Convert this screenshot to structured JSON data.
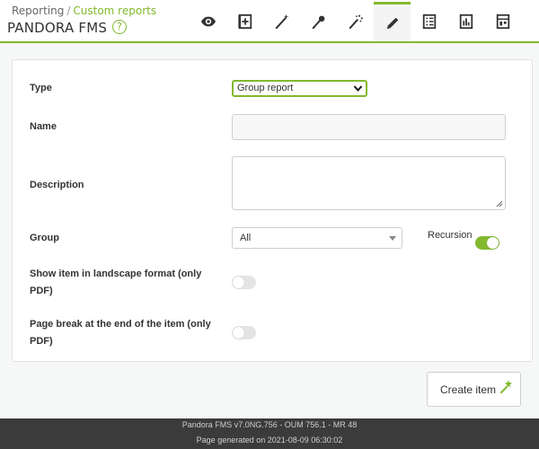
{
  "header": {
    "breadcrumb": [
      "Reporting",
      "/",
      "Custom reports"
    ],
    "title": "PANDORA FMS",
    "help_symbol": "?",
    "tabs": [
      {
        "icon": "eye-icon",
        "active": false
      },
      {
        "icon": "add-item-icon",
        "active": false
      },
      {
        "icon": "wand-icon",
        "active": false
      },
      {
        "icon": "pin-icon",
        "active": false
      },
      {
        "icon": "sparkle-wand-icon",
        "active": false
      },
      {
        "icon": "pencil-icon",
        "active": true
      },
      {
        "icon": "list-icon",
        "active": false
      },
      {
        "icon": "bar-chart-icon",
        "active": false
      },
      {
        "icon": "dashboard-icon",
        "active": false
      }
    ]
  },
  "form": {
    "type_label": "Type",
    "type_value": "Group report",
    "name_label": "Name",
    "name_value": "",
    "description_label": "Description",
    "description_value": "",
    "group_label": "Group",
    "group_value": "All",
    "recursion_label": "Recursion",
    "recursion_on": true,
    "landscape_label_1": "Show item in landscape format (only",
    "landscape_label_2": "PDF)",
    "landscape_on": false,
    "pagebreak_label_1": "Page break at the end of the item (only",
    "pagebreak_label_2": "PDF)",
    "pagebreak_on": false
  },
  "actions": {
    "create_label": "Create item"
  },
  "footer": {
    "version": "Pandora FMS v7.0NG.756 - OUM 756.1 - MR 48",
    "generated": "Page generated on 2021-08-09 06:30:02"
  },
  "colors": {
    "accent": "#82b92e",
    "footer_bg": "#3b3b3b"
  }
}
